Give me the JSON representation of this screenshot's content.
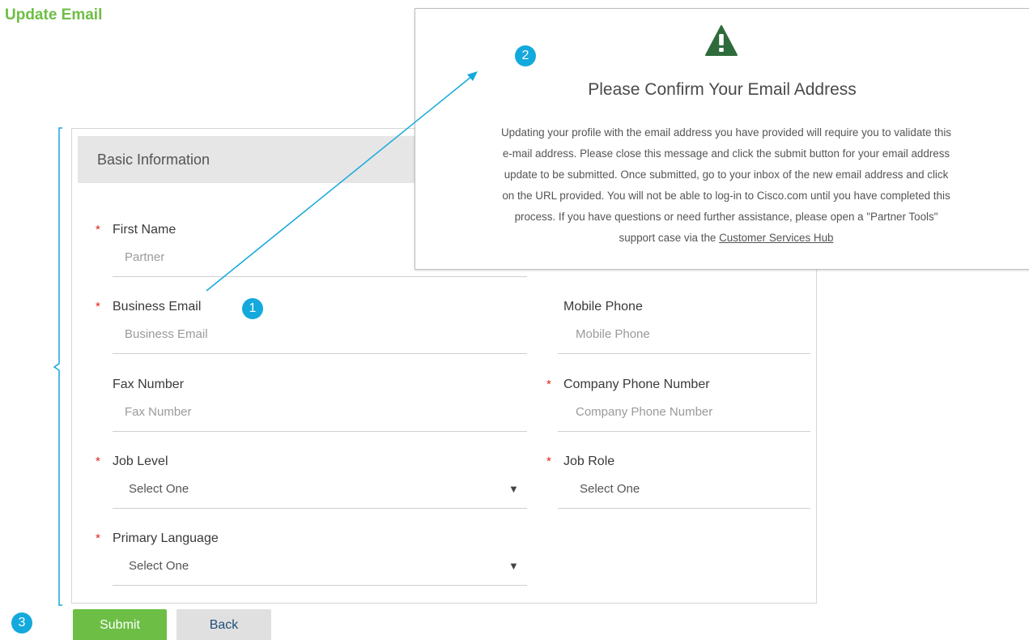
{
  "page": {
    "title": "Update Email"
  },
  "form": {
    "section_title": "Basic Information",
    "fields": {
      "first_name": {
        "label": "First Name",
        "value": "Partner",
        "required": "*"
      },
      "business_email": {
        "label": "Business Email",
        "placeholder": "Business Email",
        "required": "*"
      },
      "mobile_phone": {
        "label": "Mobile Phone",
        "placeholder": "Mobile Phone"
      },
      "fax_number": {
        "label": "Fax Number",
        "placeholder": "Fax Number"
      },
      "company_phone": {
        "label": "Company Phone Number",
        "placeholder": "Company Phone Number",
        "required": "*"
      },
      "job_level": {
        "label": "Job Level",
        "selected": "Select One",
        "required": "*"
      },
      "job_role": {
        "label": "Job Role",
        "selected": "Select One",
        "required": "*"
      },
      "primary_language": {
        "label": "Primary Language",
        "selected": "Select One",
        "required": "*"
      }
    },
    "caret_glyph": "▼"
  },
  "buttons": {
    "submit_label": "Submit",
    "back_label": "Back"
  },
  "modal": {
    "icon": "warning-triangle-icon",
    "title": "Please Confirm Your Email Address",
    "body_lines": [
      "Updating your profile with the email address you have provided will require you to validate this",
      "e-mail address. Please close this message and click the submit button for your email address",
      "update to be submitted. Once submitted, go to your inbox of the new email address and click",
      "on the URL provided. You will not be able to log-in to Cisco.com until you have completed this",
      "process. If you have questions or need further assistance, please open a \"Partner Tools\""
    ],
    "body_last_prefix": "support case via the ",
    "link_text": "Customer Services Hub"
  },
  "callouts": {
    "one": "1",
    "two": "2",
    "three": "3"
  },
  "colors": {
    "brand_green": "#6ebe44",
    "callout_blue": "#14a9dc",
    "required_red": "#e2231a",
    "warning_green": "#2e6b3a"
  }
}
